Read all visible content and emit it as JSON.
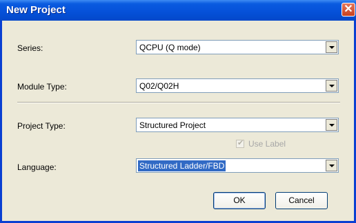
{
  "window": {
    "title": "New Project",
    "close_symbol": "✕"
  },
  "fields": {
    "series": {
      "label": "Series:",
      "value": "QCPU (Q mode)"
    },
    "module_type": {
      "label": "Module Type:",
      "value": "Q02/Q02H"
    },
    "project_type": {
      "label": "Project Type:",
      "value": "Structured Project"
    },
    "use_label": {
      "label": "Use Label",
      "checked": true,
      "enabled": false
    },
    "language": {
      "label": "Language:",
      "value": "Structured Ladder/FBD"
    }
  },
  "buttons": {
    "ok": "OK",
    "cancel": "Cancel"
  }
}
